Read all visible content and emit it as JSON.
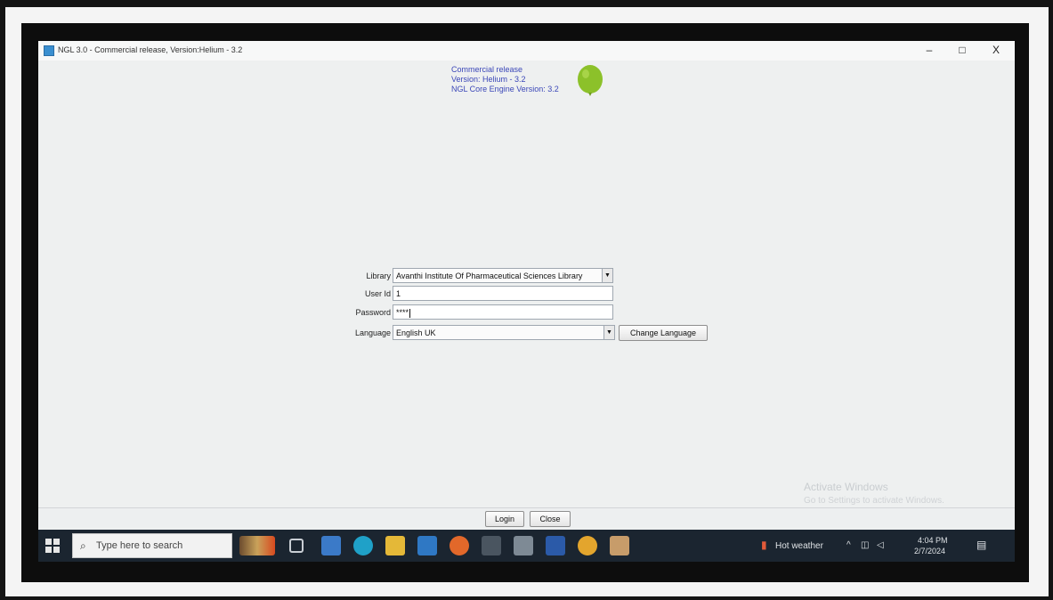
{
  "window": {
    "title": "NGL 3.0 - Commercial release, Version:Helium - 3.2",
    "minimize": "–",
    "maximize": "□",
    "close": "X"
  },
  "version_info": {
    "line1": "Commercial release",
    "line2": "Version: Helium - 3.2",
    "line3": "NGL Core Engine Version: 3.2"
  },
  "form": {
    "library_label": "Library",
    "library_value": "Avanthi Institute Of Pharmaceutical Sciences Library",
    "userid_label": "User Id",
    "userid_value": "1",
    "password_label": "Password",
    "password_value": "****",
    "language_label": "Language",
    "language_value": "English UK",
    "change_language": "Change Language",
    "dropdown_arrow": "▼"
  },
  "buttons": {
    "login": "Login",
    "close": "Close"
  },
  "activate": {
    "line1": "Activate Windows",
    "line2": "Go to Settings to activate Windows."
  },
  "taskbar": {
    "search_placeholder": "Type here to search",
    "weather": "Hot weather",
    "time": "4:04 PM",
    "date": "2/7/2024",
    "icons": [
      "task-view-icon",
      "store-icon",
      "edge-icon",
      "file-explorer-icon",
      "mail-icon",
      "firefox-icon",
      "terminal-icon",
      "app-icon",
      "word-icon",
      "chrome-icon",
      "ngl-app-icon"
    ]
  },
  "colors": {
    "version_text": "#3b47b8",
    "balloon": "#8cc12a",
    "taskbar": "#1b2530"
  }
}
